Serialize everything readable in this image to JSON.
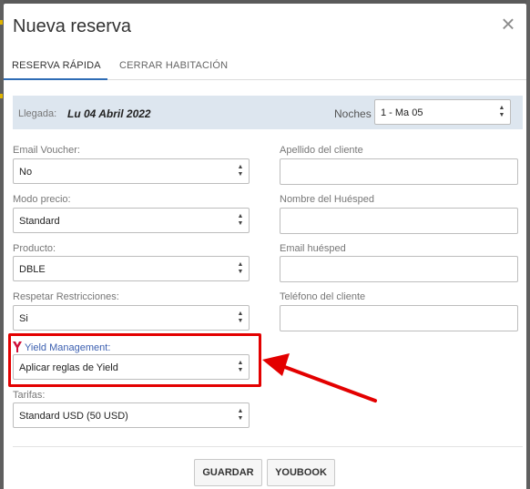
{
  "modal": {
    "title": "Nueva reserva",
    "close_glyph": "×"
  },
  "tabs": [
    {
      "label": "RESERVA RÁPIDA",
      "active": true
    },
    {
      "label": "CERRAR HABITACIÓN",
      "active": false
    }
  ],
  "arrival": {
    "label": "Llegada:",
    "date": "Lu 04 Abril 2022",
    "nights_label": "Noches",
    "nights_value": "1 - Ma 05"
  },
  "left_fields": {
    "email_voucher": {
      "label": "Email Voucher:",
      "value": "No"
    },
    "modo_precio": {
      "label": "Modo precio:",
      "value": "Standard"
    },
    "producto": {
      "label": "Producto:",
      "value": "DBLE"
    },
    "respetar": {
      "label": "Respetar Restricciones:",
      "value": "Si"
    },
    "yield": {
      "label": "Yield Management:",
      "value": "Aplicar reglas de Yield"
    },
    "tarifas": {
      "label": "Tarifas:",
      "value": "Standard USD (50 USD)"
    }
  },
  "right_fields": {
    "apellido": {
      "label": "Apellido del cliente",
      "value": ""
    },
    "nombre_huesped": {
      "label": "Nombre del Huésped",
      "value": ""
    },
    "email_huesped": {
      "label": "Email huésped",
      "value": ""
    },
    "telefono": {
      "label": "Teléfono del cliente",
      "value": ""
    }
  },
  "buttons": {
    "guardar": "GUARDAR",
    "youbook": "YOUBOOK"
  },
  "colors": {
    "accent": "#2e6cb5",
    "highlight": "#e30000",
    "yield_label": "#3b5fb0",
    "arrival_bg": "#dde6ef"
  }
}
